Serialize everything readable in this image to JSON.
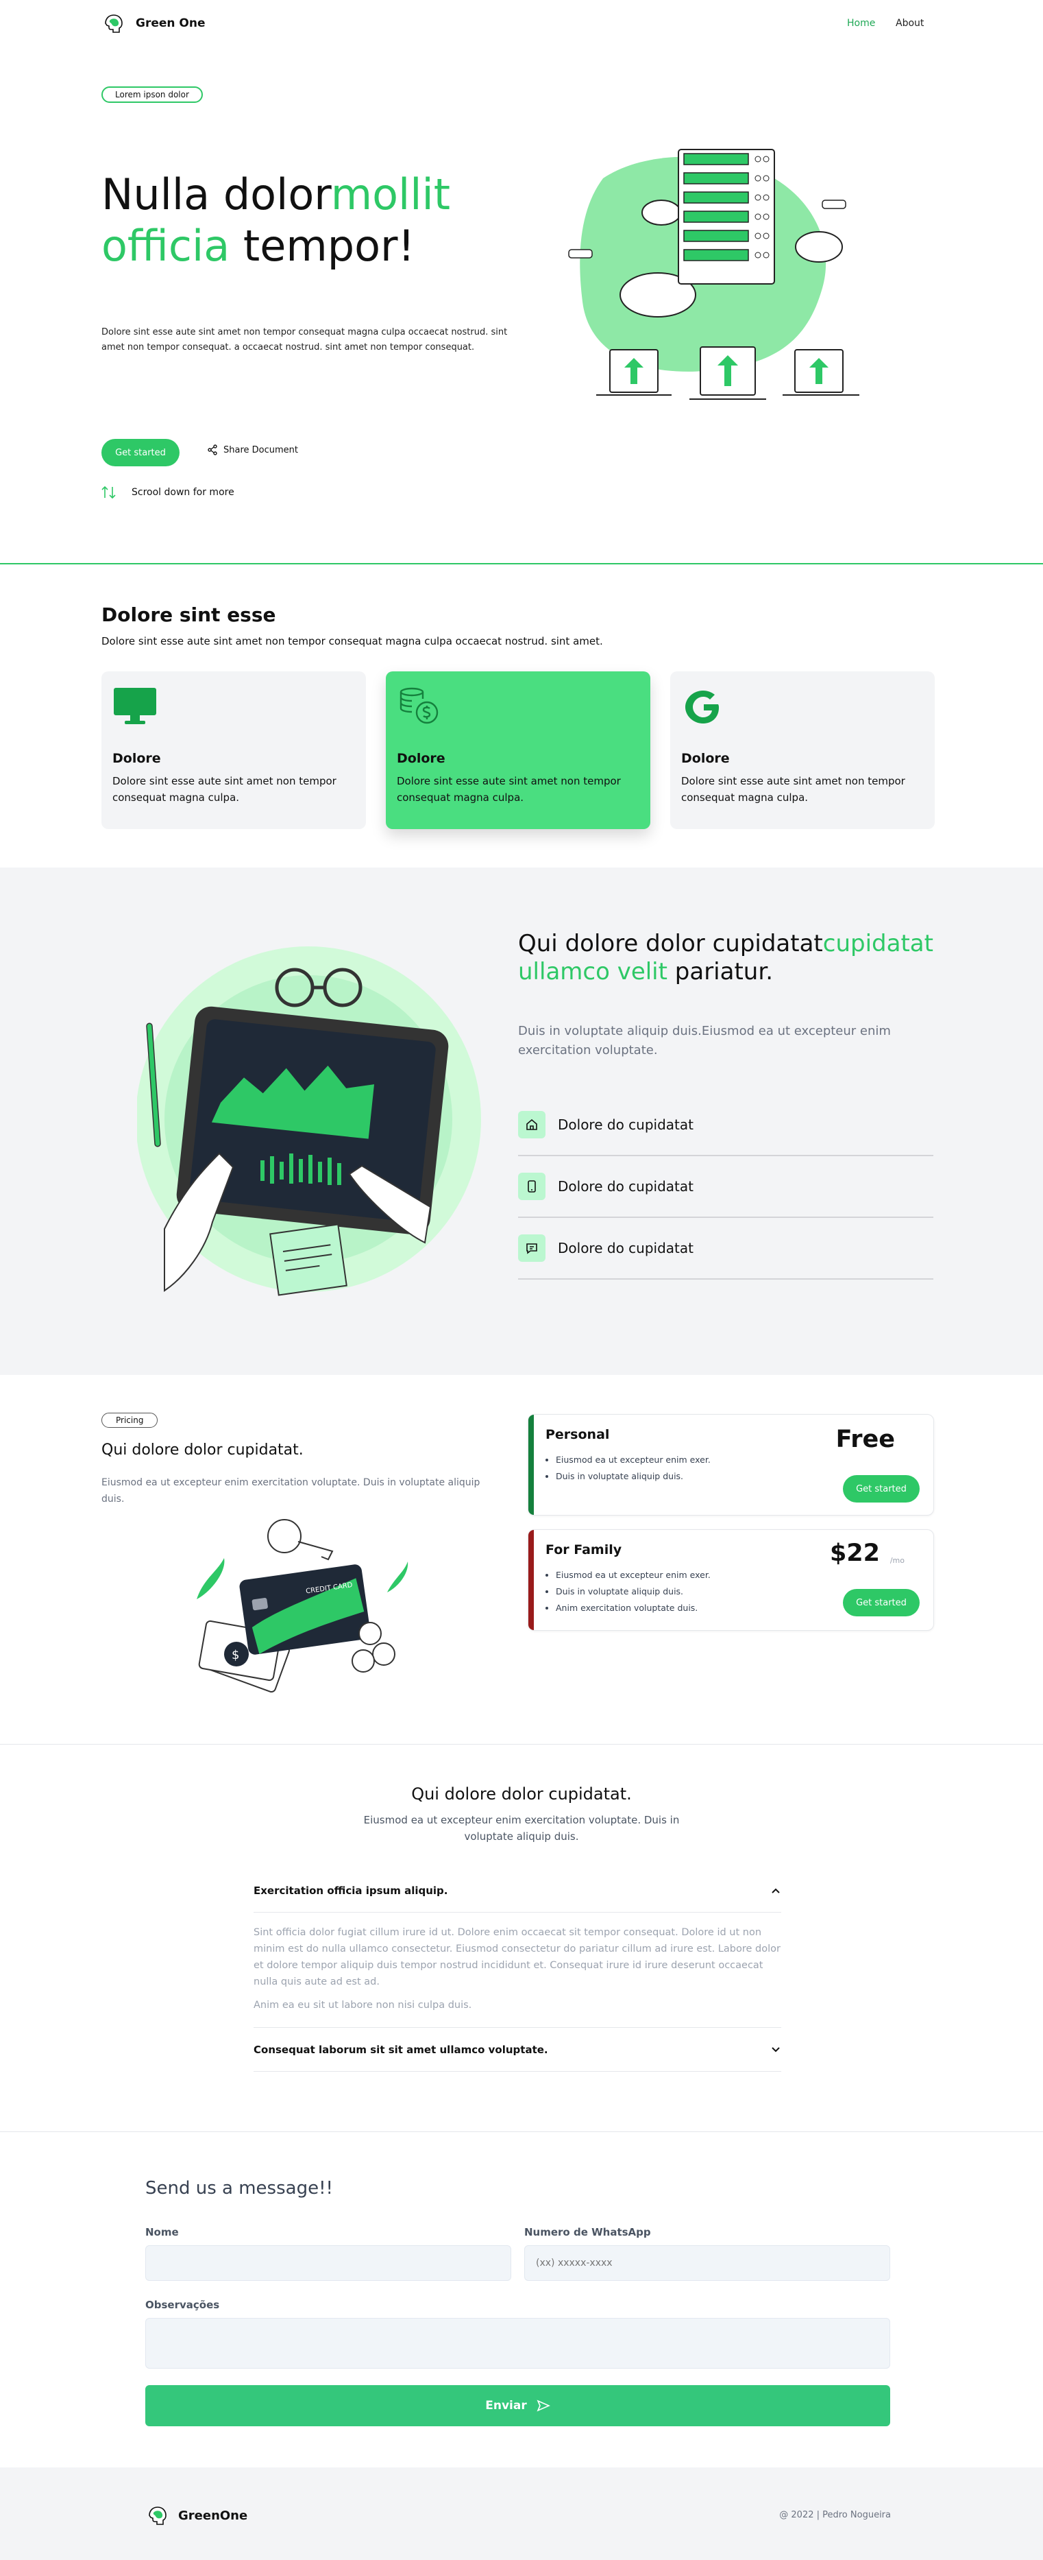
{
  "header": {
    "brand": "Green One",
    "nav": [
      {
        "label": "Home"
      },
      {
        "label": "About"
      }
    ]
  },
  "hero": {
    "badge": "Lorem ipson dolor",
    "title_a": "Nulla dolor",
    "title_b": "mollit",
    "title_c": "officia",
    "title_d": " tempor!",
    "description": "Dolore sint esse aute sint amet non tempor consequat magna culpa occaecat nostrud. sint amet non tempor consequat. a occaecat nostrud. sint amet non tempor consequat.",
    "cta": "Get started",
    "share": "Share Document",
    "scroll": "Scrool down for more"
  },
  "services": {
    "title": "Dolore sint esse",
    "subtitle": "Dolore sint esse aute sint amet non tempor consequat magna culpa occaecat nostrud. sint amet.",
    "cards": [
      {
        "title": "Dolore",
        "text": "Dolore sint esse aute sint amet non tempor consequat magna culpa.",
        "icon": "monitor-icon"
      },
      {
        "title": "Dolore",
        "text": "Dolore sint esse aute sint amet non tempor consequat magna culpa.",
        "icon": "coins-icon"
      },
      {
        "title": "Dolore",
        "text": "Dolore sint esse aute sint amet non tempor consequat magna culpa.",
        "icon": "google-icon"
      }
    ]
  },
  "features": {
    "title_a": "Qui dolore dolor cupidatat",
    "title_b": "cupidatat ullamco velit",
    "title_c": " pariatur.",
    "description": "Duis in voluptate aliquip duis.Eiusmod ea ut excepteur enim exercitation voluptate.",
    "items": [
      {
        "label": "Dolore do cupidatat",
        "icon": "home-icon"
      },
      {
        "label": "Dolore do cupidatat",
        "icon": "phone-icon"
      },
      {
        "label": "Dolore do cupidatat",
        "icon": "chat-icon"
      }
    ]
  },
  "pricing": {
    "badge": "Pricing",
    "title": "Qui dolore dolor cupidatat.",
    "description": "Eiusmod ea ut excepteur enim exercitation voluptate. Duis in voluptate aliquip duis.",
    "card_label": "CREDIT CARD",
    "plans": [
      {
        "name": "Personal",
        "price": "Free",
        "period": "",
        "features": [
          "Eiusmod ea ut excepteur enim exer.",
          "Duis in voluptate aliquip duis."
        ],
        "cta": "Get started",
        "accent": "#15803d"
      },
      {
        "name": "For Family",
        "price": "$22",
        "period": "/mo",
        "features": [
          "Eiusmod ea ut excepteur enim exer.",
          "Duis in voluptate aliquip duis.",
          "Anim exercitation voluptate duis."
        ],
        "cta": "Get started",
        "accent": "#991b1b"
      }
    ]
  },
  "faq": {
    "title": "Qui dolore dolor cupidatat.",
    "subtitle": "Eiusmod ea ut excepteur enim exercitation voluptate. Duis in voluptate aliquip duis.",
    "items": [
      {
        "question": "Exercitation officia ipsum aliquip.",
        "answer": "Sint officia dolor fugiat cillum irure id ut. Dolore enim occaecat sit tempor consequat. Dolore id ut non minim est do nulla ullamco consectetur. Eiusmod consectetur do pariatur cillum ad irure est. Labore dolor et dolore tempor aliquip duis tempor nostrud incididunt et. Consequat irure id irure deserunt occaecat nulla quis aute ad est ad.",
        "answer2": "Anim ea eu sit ut labore non nisi culpa duis."
      },
      {
        "question": "Consequat laborum sit sit amet ullamco voluptate."
      }
    ]
  },
  "contact": {
    "title": "Send us a message!!",
    "name_label": "Nome",
    "whatsapp_label": "Numero de WhatsApp",
    "whatsapp_placeholder": "(xx) xxxxx-xxxx",
    "notes_label": "Observações",
    "submit": "Enviar"
  },
  "footer": {
    "brand": "GreenOne",
    "copyright": "@ 2022 | Pedro Nogueira"
  },
  "colors": {
    "accent": "#2ec866",
    "accent_light": "#4ade80",
    "muted_bg": "#f3f4f6"
  }
}
